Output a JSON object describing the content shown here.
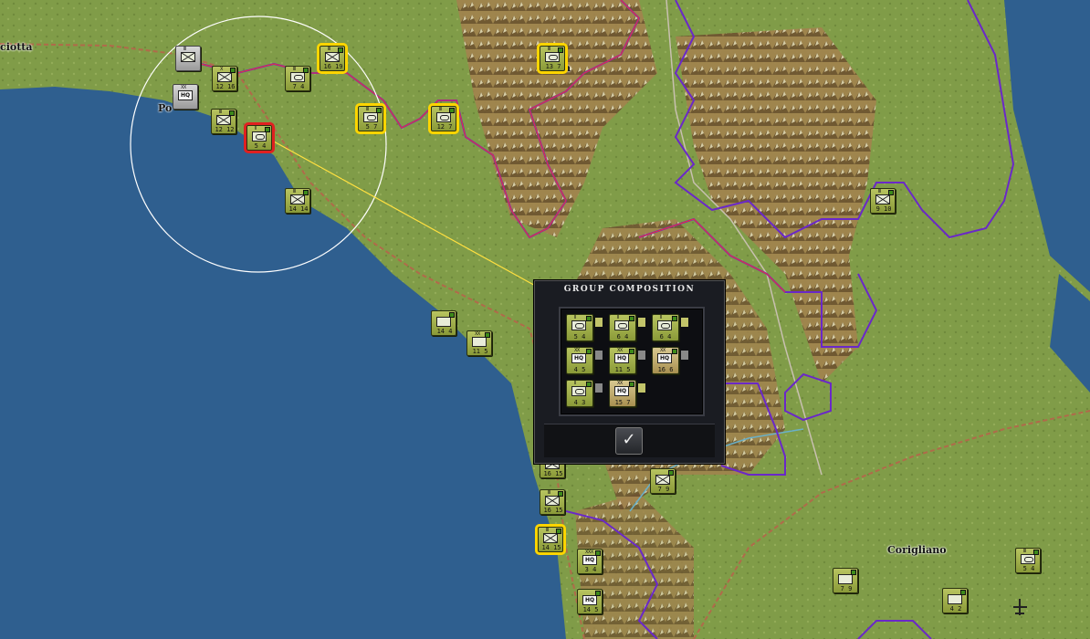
{
  "map": {
    "colors": {
      "sea": "#2f5f8f",
      "land": "#7f9a46",
      "mountain": "#8a6a40",
      "zoc": "#6a28c8",
      "road": "#b06a4a"
    },
    "places": [
      {
        "id": "p1",
        "name": "ciotta"
      },
      {
        "id": "p2",
        "name": "Po"
      },
      {
        "id": "p3",
        "name": "Corigliano"
      },
      {
        "id": "p4",
        "name": "a"
      }
    ],
    "units": [
      {
        "id": "u1",
        "size": "III",
        "type": "inf",
        "str": "",
        "style": "grey"
      },
      {
        "id": "u2",
        "size": "XX",
        "type": "hq",
        "str": "",
        "style": "grey"
      },
      {
        "id": "u3",
        "size": "X",
        "type": "inf",
        "str": "12 16",
        "style": ""
      },
      {
        "id": "u4",
        "size": "III",
        "type": "mech",
        "str": "7 4",
        "style": ""
      },
      {
        "id": "u5",
        "size": "III",
        "type": "inf",
        "str": "16 19",
        "style": "sel"
      },
      {
        "id": "u6",
        "size": "III",
        "type": "mech",
        "str": "13 7",
        "style": "sel"
      },
      {
        "id": "u7",
        "size": "III",
        "type": "inf",
        "str": "12 12",
        "style": ""
      },
      {
        "id": "u8",
        "size": "II",
        "type": "mech",
        "str": "5 4",
        "style": "active"
      },
      {
        "id": "u9",
        "size": "III",
        "type": "mech",
        "str": "5 7",
        "style": "sel"
      },
      {
        "id": "u10",
        "size": "III",
        "type": "mech",
        "str": "12 7",
        "style": "sel"
      },
      {
        "id": "u11",
        "size": "III",
        "type": "inf",
        "str": "14 14",
        "style": ""
      },
      {
        "id": "u12",
        "size": "III",
        "type": "inf",
        "str": "9 10",
        "style": ""
      },
      {
        "id": "u13",
        "size": "",
        "type": "",
        "str": "14 4",
        "style": ""
      },
      {
        "id": "u14",
        "size": "XX",
        "type": "",
        "str": "11 5",
        "style": ""
      },
      {
        "id": "u15",
        "size": "",
        "type": "inf",
        "str": "16 15",
        "style": ""
      },
      {
        "id": "u16",
        "size": "III",
        "type": "inf",
        "str": "16 15",
        "style": ""
      },
      {
        "id": "u17",
        "size": "III",
        "type": "inf",
        "str": "14 15",
        "style": "sel"
      },
      {
        "id": "u18",
        "size": "XXX",
        "type": "hq",
        "str": "3 4",
        "style": ""
      },
      {
        "id": "u19",
        "size": "",
        "type": "hq",
        "str": "14 5",
        "style": ""
      },
      {
        "id": "u20",
        "size": "",
        "type": "inf",
        "str": "7 9",
        "style": ""
      },
      {
        "id": "u21",
        "size": "",
        "type": "",
        "str": "7 9",
        "style": ""
      },
      {
        "id": "u22",
        "size": "",
        "type": "",
        "str": "4 2",
        "style": ""
      },
      {
        "id": "u23",
        "size": "III",
        "type": "mech",
        "str": "5 4",
        "style": ""
      }
    ]
  },
  "dialog": {
    "title": "GROUP COMPOSITION",
    "ok_label": "✓",
    "units": [
      {
        "size": "II",
        "type": "mech",
        "str": "5 4"
      },
      {
        "size": "II",
        "type": "mech",
        "str": "6 4"
      },
      {
        "size": "II",
        "type": "mech",
        "str": "6 4"
      },
      {
        "size": "XX",
        "type": "hq",
        "str": "4 5"
      },
      {
        "size": "XX",
        "type": "hq",
        "str": "11 5"
      },
      {
        "size": "XX",
        "type": "hq",
        "str": "16 6"
      },
      {
        "size": "II",
        "type": "mech",
        "str": "4 3"
      },
      {
        "size": "XX",
        "type": "hq",
        "str": "15 7"
      }
    ]
  }
}
